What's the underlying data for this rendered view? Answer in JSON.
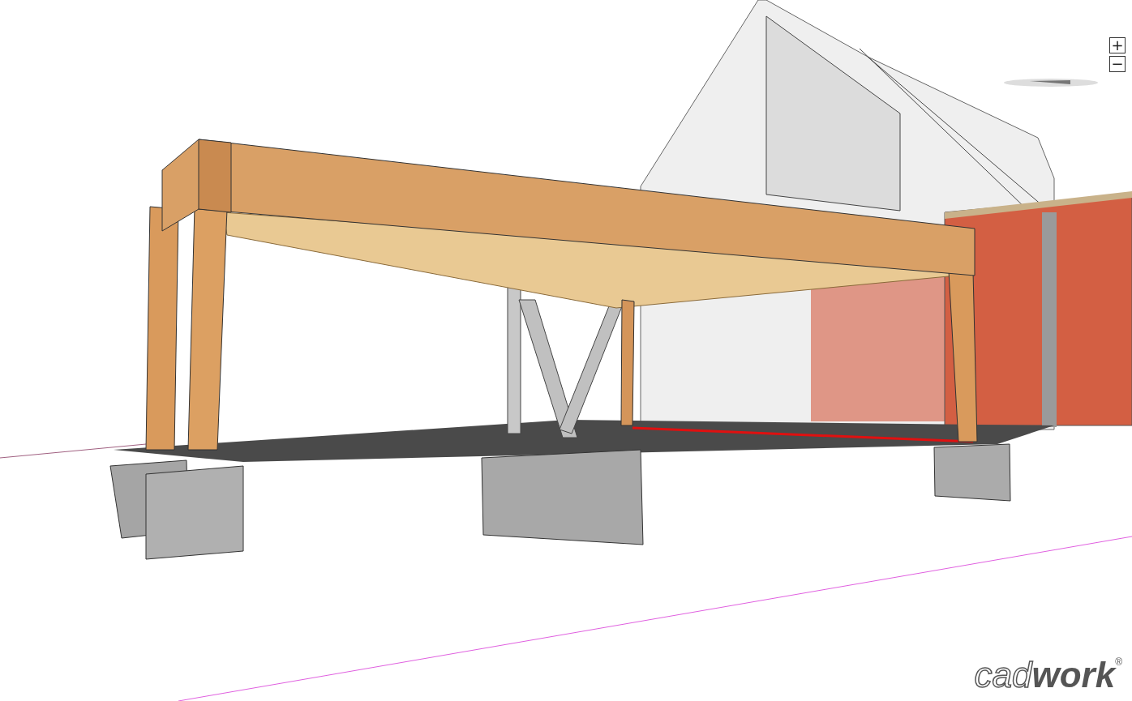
{
  "zoom_controls": [
    "+",
    "−"
  ],
  "logo": {
    "text": "cad**work**$^{®}$"
  }
}
